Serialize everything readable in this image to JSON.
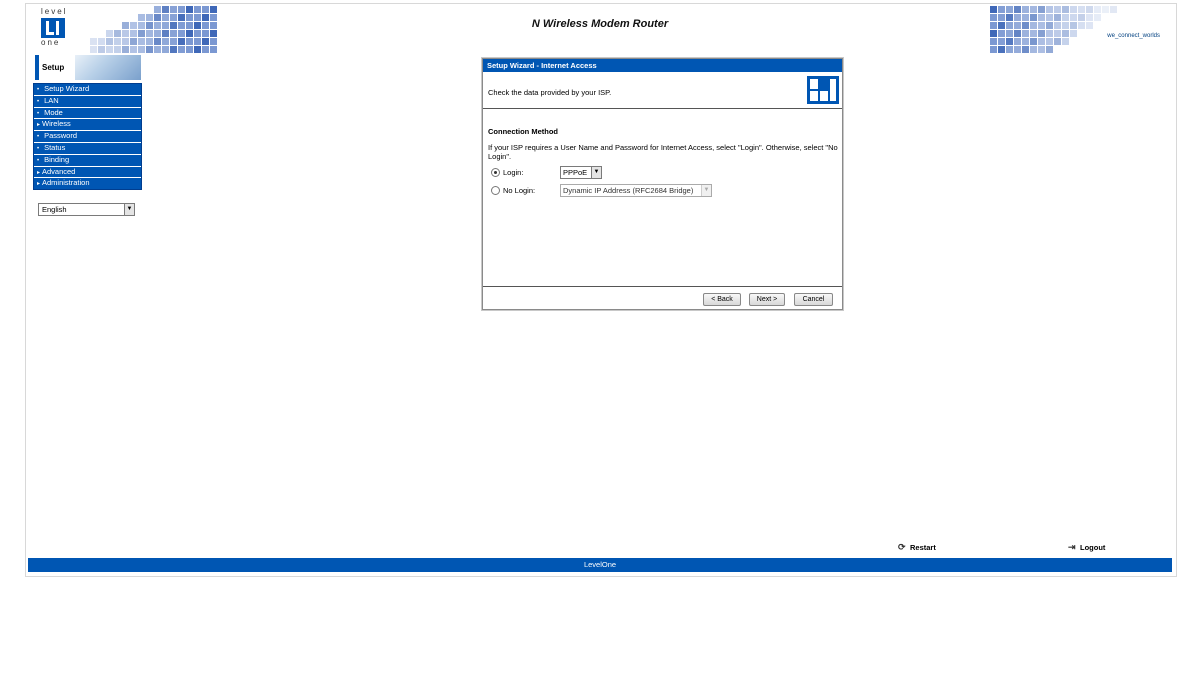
{
  "header": {
    "logo_text_top": "level",
    "logo_text_bottom": "one",
    "title": "N Wireless Modem Router",
    "slogan": "we_connect_worlds"
  },
  "sidebar": {
    "section_title": "Setup",
    "items": [
      {
        "label": "Setup Wizard",
        "marker": "•"
      },
      {
        "label": "LAN",
        "marker": "•"
      },
      {
        "label": "Mode",
        "marker": "•"
      },
      {
        "label": "Wireless",
        "marker": "▸"
      },
      {
        "label": "Password",
        "marker": "•"
      },
      {
        "label": "Status",
        "marker": "•"
      },
      {
        "label": "Binding",
        "marker": "•"
      },
      {
        "label": "Advanced",
        "marker": "▸"
      },
      {
        "label": "Administration",
        "marker": "▸"
      }
    ],
    "language": "English"
  },
  "dialog": {
    "title": "Setup Wizard - Internet Access",
    "subtitle": "Check the data provided by your ISP.",
    "section": "Connection Method",
    "description": "If your ISP requires a User Name and Password for Internet Access, select \"Login\". Otherwise, select \"No Login\".",
    "login_label": "Login:",
    "login_value": "PPPoE",
    "nologin_label": "No Login:",
    "nologin_value": "Dynamic IP Address (RFC2684 Bridge)",
    "back": "< Back",
    "next": "Next >",
    "cancel": "Cancel"
  },
  "actions": {
    "restart": "Restart",
    "logout": "Logout"
  },
  "footer": "LevelOne",
  "colors": {
    "brand_blue": "#0056b3"
  }
}
